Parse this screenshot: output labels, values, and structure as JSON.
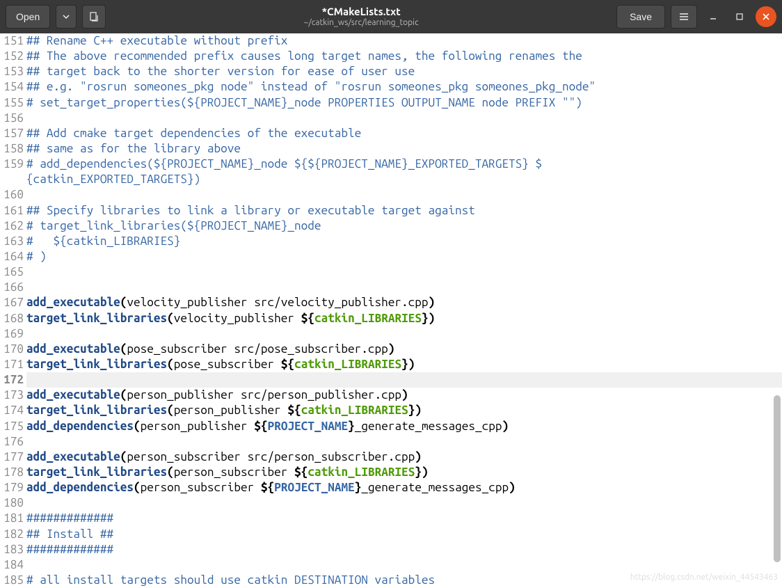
{
  "titlebar": {
    "open": "Open",
    "save": "Save",
    "filename": "*CMakeLists.txt",
    "path": "~/catkin_ws/src/learning_topic"
  },
  "watermark": "https://blog.csdn.net/weixin_44543463",
  "lines": [
    {
      "n": 151,
      "seg": [
        {
          "cls": "c-comment",
          "t": "## Rename C++ executable without prefix"
        }
      ]
    },
    {
      "n": 152,
      "seg": [
        {
          "cls": "c-comment",
          "t": "## The above recommended prefix causes long target names, the following renames the"
        }
      ]
    },
    {
      "n": 153,
      "seg": [
        {
          "cls": "c-comment",
          "t": "## target back to the shorter version for ease of user use"
        }
      ]
    },
    {
      "n": 154,
      "seg": [
        {
          "cls": "c-comment",
          "t": "## e.g. \"rosrun someones_pkg node\" instead of \"rosrun someones_pkg someones_pkg_node\""
        }
      ]
    },
    {
      "n": 155,
      "seg": [
        {
          "cls": "c-comment",
          "t": "# set_target_properties(${PROJECT_NAME}_node PROPERTIES OUTPUT_NAME node PREFIX \"\")"
        }
      ]
    },
    {
      "n": 156,
      "seg": []
    },
    {
      "n": 157,
      "seg": [
        {
          "cls": "c-comment",
          "t": "## Add cmake target dependencies of the executable"
        }
      ]
    },
    {
      "n": 158,
      "seg": [
        {
          "cls": "c-comment",
          "t": "## same as for the library above"
        }
      ]
    },
    {
      "n": 159,
      "seg": [
        {
          "cls": "c-comment",
          "t": "# add_dependencies(${PROJECT_NAME}_node ${${PROJECT_NAME}_EXPORTED_TARGETS} ${catkin_EXPORTED_TARGETS})"
        }
      ],
      "wrap": true
    },
    {
      "n": 160,
      "seg": []
    },
    {
      "n": 161,
      "seg": [
        {
          "cls": "c-comment",
          "t": "## Specify libraries to link a library or executable target against"
        }
      ]
    },
    {
      "n": 162,
      "seg": [
        {
          "cls": "c-comment",
          "t": "# target_link_libraries(${PROJECT_NAME}_node"
        }
      ]
    },
    {
      "n": 163,
      "seg": [
        {
          "cls": "c-comment",
          "t": "#   ${catkin_LIBRARIES}"
        }
      ]
    },
    {
      "n": 164,
      "seg": [
        {
          "cls": "c-comment",
          "t": "# )"
        }
      ]
    },
    {
      "n": 165,
      "seg": []
    },
    {
      "n": 166,
      "seg": []
    },
    {
      "n": 167,
      "seg": [
        {
          "cls": "c-func",
          "t": "add_executable"
        },
        {
          "cls": "c-plain c-bold",
          "t": "("
        },
        {
          "cls": "c-plain",
          "t": "velocity_publisher src/velocity_publisher.cpp"
        },
        {
          "cls": "c-plain c-bold",
          "t": ")"
        }
      ]
    },
    {
      "n": 168,
      "seg": [
        {
          "cls": "c-func",
          "t": "target_link_libraries"
        },
        {
          "cls": "c-plain c-bold",
          "t": "("
        },
        {
          "cls": "c-plain",
          "t": "velocity_publisher "
        },
        {
          "cls": "c-plain c-bold",
          "t": "${"
        },
        {
          "cls": "c-var",
          "t": "catkin_LIBRARIES"
        },
        {
          "cls": "c-plain c-bold",
          "t": "}"
        },
        {
          "cls": "c-plain c-bold",
          "t": ")"
        }
      ]
    },
    {
      "n": 169,
      "seg": []
    },
    {
      "n": 170,
      "seg": [
        {
          "cls": "c-func",
          "t": "add_executable"
        },
        {
          "cls": "c-plain c-bold",
          "t": "("
        },
        {
          "cls": "c-plain",
          "t": "pose_subscriber src/pose_subscriber.cpp"
        },
        {
          "cls": "c-plain c-bold",
          "t": ")"
        }
      ]
    },
    {
      "n": 171,
      "seg": [
        {
          "cls": "c-func",
          "t": "target_link_libraries"
        },
        {
          "cls": "c-plain c-bold",
          "t": "("
        },
        {
          "cls": "c-plain",
          "t": "pose_subscriber "
        },
        {
          "cls": "c-plain c-bold",
          "t": "${"
        },
        {
          "cls": "c-var",
          "t": "catkin_LIBRARIES"
        },
        {
          "cls": "c-plain c-bold",
          "t": "}"
        },
        {
          "cls": "c-plain c-bold",
          "t": ")"
        }
      ]
    },
    {
      "n": 172,
      "seg": [],
      "cursor": true
    },
    {
      "n": 173,
      "seg": [
        {
          "cls": "c-func",
          "t": "add_executable"
        },
        {
          "cls": "c-plain c-bold",
          "t": "("
        },
        {
          "cls": "c-plain",
          "t": "person_publisher src/person_publisher.cpp"
        },
        {
          "cls": "c-plain c-bold",
          "t": ")"
        }
      ]
    },
    {
      "n": 174,
      "seg": [
        {
          "cls": "c-func",
          "t": "target_link_libraries"
        },
        {
          "cls": "c-plain c-bold",
          "t": "("
        },
        {
          "cls": "c-plain",
          "t": "person_publisher "
        },
        {
          "cls": "c-plain c-bold",
          "t": "${"
        },
        {
          "cls": "c-var",
          "t": "catkin_LIBRARIES"
        },
        {
          "cls": "c-plain c-bold",
          "t": "}"
        },
        {
          "cls": "c-plain c-bold",
          "t": ")"
        }
      ]
    },
    {
      "n": 175,
      "seg": [
        {
          "cls": "c-func",
          "t": "add_dependencies"
        },
        {
          "cls": "c-plain c-bold",
          "t": "("
        },
        {
          "cls": "c-plain",
          "t": "person_publisher "
        },
        {
          "cls": "c-plain c-bold",
          "t": "${"
        },
        {
          "cls": "c-proj",
          "t": "PROJECT_NAME"
        },
        {
          "cls": "c-plain c-bold",
          "t": "}"
        },
        {
          "cls": "c-plain",
          "t": "_generate_messages_cpp"
        },
        {
          "cls": "c-plain c-bold",
          "t": ")"
        }
      ]
    },
    {
      "n": 176,
      "seg": []
    },
    {
      "n": 177,
      "seg": [
        {
          "cls": "c-func",
          "t": "add_executable"
        },
        {
          "cls": "c-plain c-bold",
          "t": "("
        },
        {
          "cls": "c-plain",
          "t": "person_subscriber src/person_subscriber.cpp"
        },
        {
          "cls": "c-plain c-bold",
          "t": ")"
        }
      ]
    },
    {
      "n": 178,
      "seg": [
        {
          "cls": "c-func",
          "t": "target_link_libraries"
        },
        {
          "cls": "c-plain c-bold",
          "t": "("
        },
        {
          "cls": "c-plain",
          "t": "person_subscriber "
        },
        {
          "cls": "c-plain c-bold",
          "t": "${"
        },
        {
          "cls": "c-var",
          "t": "catkin_LIBRARIES"
        },
        {
          "cls": "c-plain c-bold",
          "t": "}"
        },
        {
          "cls": "c-plain c-bold",
          "t": ")"
        }
      ]
    },
    {
      "n": 179,
      "seg": [
        {
          "cls": "c-func",
          "t": "add_dependencies"
        },
        {
          "cls": "c-plain c-bold",
          "t": "("
        },
        {
          "cls": "c-plain",
          "t": "person_subscriber "
        },
        {
          "cls": "c-plain c-bold",
          "t": "${"
        },
        {
          "cls": "c-proj",
          "t": "PROJECT_NAME"
        },
        {
          "cls": "c-plain c-bold",
          "t": "}"
        },
        {
          "cls": "c-plain",
          "t": "_generate_messages_cpp"
        },
        {
          "cls": "c-plain c-bold",
          "t": ")"
        }
      ]
    },
    {
      "n": 180,
      "seg": []
    },
    {
      "n": 181,
      "seg": [
        {
          "cls": "c-comment",
          "t": "#############"
        }
      ]
    },
    {
      "n": 182,
      "seg": [
        {
          "cls": "c-comment",
          "t": "## Install ##"
        }
      ]
    },
    {
      "n": 183,
      "seg": [
        {
          "cls": "c-comment",
          "t": "#############"
        }
      ]
    },
    {
      "n": 184,
      "seg": []
    },
    {
      "n": 185,
      "seg": [
        {
          "cls": "c-comment",
          "t": "# all install targets should use catkin DESTINATION variables"
        }
      ]
    }
  ]
}
